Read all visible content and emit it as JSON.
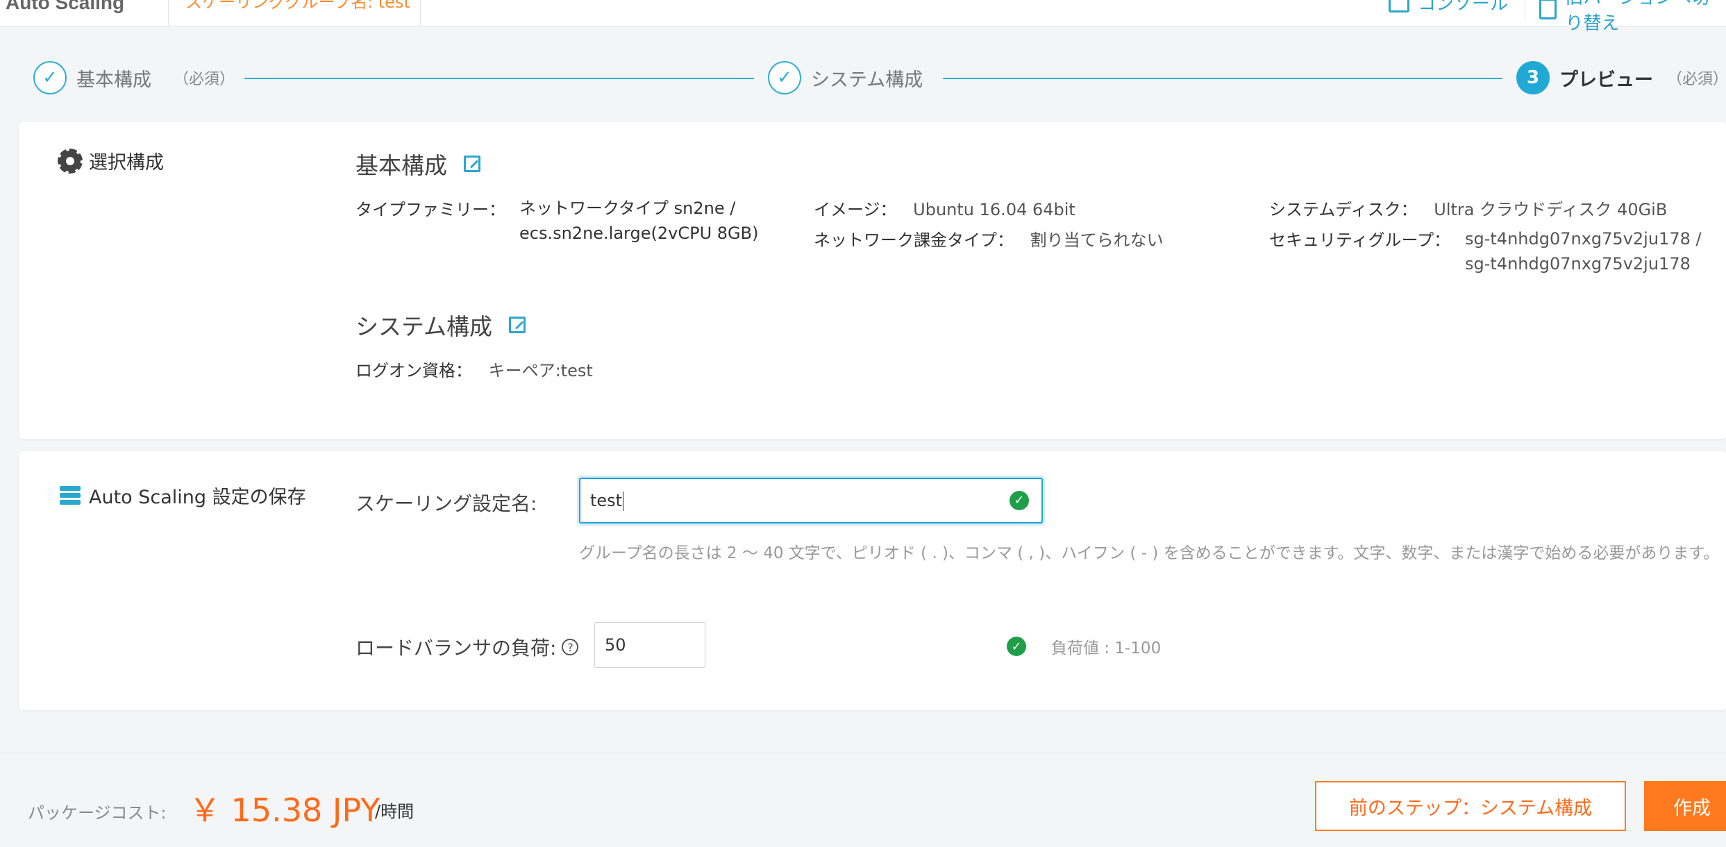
{
  "header": {
    "app_title": "Auto Scaling",
    "tab": "スケーリンググループ名: test",
    "console_label": "コンソール",
    "legacy_label": "旧バージョンへ切り替え"
  },
  "steps": [
    {
      "label": "基本構成",
      "sub": "（必須）",
      "marker": "✓"
    },
    {
      "label": "システム構成",
      "sub": "",
      "marker": "✓"
    },
    {
      "label": "プレビュー",
      "sub": "（必須）",
      "marker": "3"
    }
  ],
  "selection": {
    "title": "選択構成",
    "basic": {
      "heading": "基本構成",
      "type_family_label": "タイプファミリー：",
      "type_family_value_1": "ネットワークタイプ sn2ne /",
      "type_family_value_2": "ecs.sn2ne.large(2vCPU 8GB)",
      "image_label": "イメージ：",
      "image_value": "Ubuntu 16.04 64bit",
      "billing_label": "ネットワーク課金タイプ：",
      "billing_value": "割り当てられない",
      "disk_label": "システムディスク：",
      "disk_value": "Ultra クラウドディスク 40GiB",
      "sg_label": "セキュリティグループ：",
      "sg_value_1": "sg-t4nhdg07nxg75v2ju178 /",
      "sg_value_2": "sg-t4nhdg07nxg75v2ju178"
    },
    "system": {
      "heading": "システム構成",
      "logon_label": "ログオン資格：",
      "logon_value": "キーペア:test"
    }
  },
  "save": {
    "title": "Auto Scaling 設定の保存",
    "name_label": "スケーリング設定名:",
    "name_value": "test",
    "name_hint": "グループ名の長さは 2 ～ 40 文字で、ピリオド ( . )、コンマ ( , )、ハイフン ( - ) を含めることができます。文字、数字、または漢字で始める必要があります。",
    "weight_label": "ロードバランサの負荷:",
    "weight_value": "50",
    "weight_range": "負荷値 : 1-100"
  },
  "footer": {
    "cost_label": "パッケージコスト:",
    "cost_value": "￥ 15.38 JPY",
    "cost_unit": "/時間",
    "prev_button": "前のステップ：システム構成",
    "create_button": "作成"
  },
  "colors": {
    "accent_blue": "#21a9d6",
    "accent_orange": "#ff7a1f",
    "success_green": "#1f9e4a"
  }
}
